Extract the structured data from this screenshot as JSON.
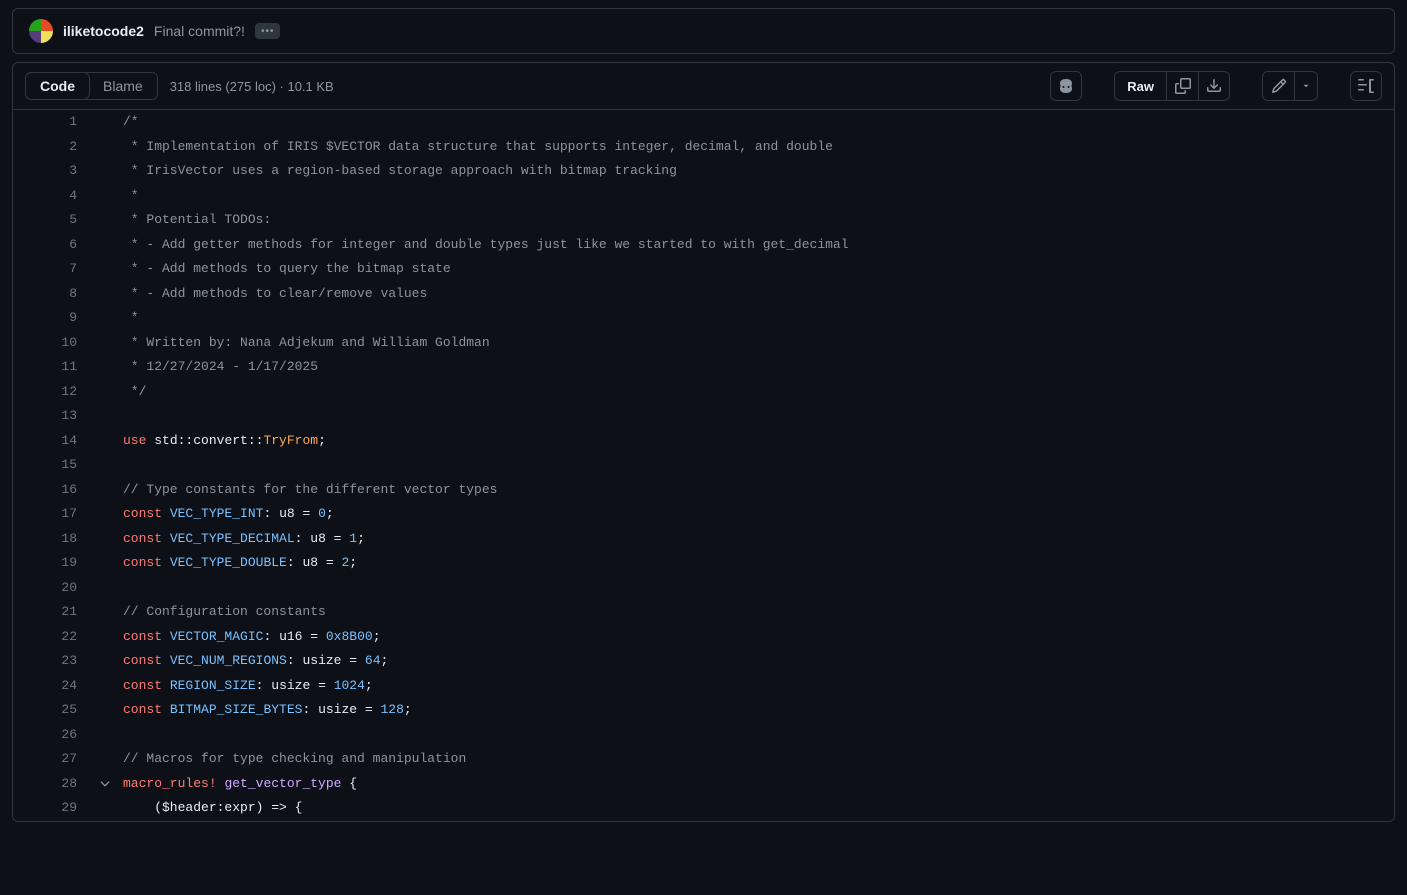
{
  "commit": {
    "author": "iliketocode2",
    "message": "Final commit?!",
    "ellipsis": "•••"
  },
  "tabs": {
    "code": "Code",
    "blame": "Blame"
  },
  "fileinfo": "318 lines (275 loc) · 10.1 KB",
  "raw_label": "Raw",
  "code": {
    "l1": "/*",
    "l2": " * Implementation of IRIS $VECTOR data structure that supports integer, decimal, and double",
    "l3": " * IrisVector uses a region-based storage approach with bitmap tracking",
    "l4": " *",
    "l5": " * Potential TODOs:",
    "l6": " * - Add getter methods for integer and double types just like we started to with get_decimal",
    "l7": " * - Add methods to query the bitmap state",
    "l8": " * - Add methods to clear/remove values",
    "l9": " *",
    "l10": " * Written by: Nana Adjekum and William Goldman",
    "l11": " * 12/27/2024 - 1/17/2025",
    "l12": " */",
    "l16": "// Type constants for the different vector types",
    "l21": "// Configuration constants",
    "l27": "// Macros for type checking and manipulation",
    "kw_use": "use",
    "kw_const": "const",
    "kw_macro": "macro_rules!",
    "std": "std",
    "convert": "convert",
    "tryfrom": "TryFrom",
    "vti": "VEC_TYPE_INT",
    "vtd": "VEC_TYPE_DECIMAL",
    "vtdb": "VEC_TYPE_DOUBLE",
    "vm": "VECTOR_MAGIC",
    "vnr": "VEC_NUM_REGIONS",
    "rs": "REGION_SIZE",
    "bsb": "BITMAP_SIZE_BYTES",
    "gvt": "get_vector_type",
    "u8": "u8",
    "u16": "u16",
    "usize": "usize",
    "n0": "0",
    "n1": "1",
    "n2": "2",
    "hex": "0x8B00",
    "n64": "64",
    "n1024": "1024",
    "n128": "128",
    "l29": "    ($header:expr) => {"
  }
}
